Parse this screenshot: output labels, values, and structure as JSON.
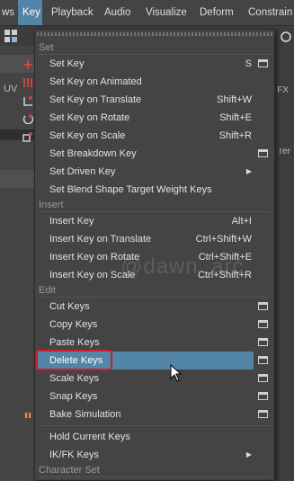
{
  "menubar": {
    "items": [
      {
        "label": "ws"
      },
      {
        "label": "Key"
      },
      {
        "label": "Playback"
      },
      {
        "label": "Audio"
      },
      {
        "label": "Visualize"
      },
      {
        "label": "Deform"
      },
      {
        "label": "Constrain"
      }
    ],
    "active": "Key"
  },
  "background": {
    "left_tab": "UV",
    "right_tab": "FX",
    "right_text": "rer"
  },
  "menu": {
    "sections": {
      "set": "Set",
      "insert": "Insert",
      "edit": "Edit",
      "character_set": "Character Set"
    },
    "items": [
      {
        "label": "Set Key",
        "shortcut": "S",
        "has_options": true
      },
      {
        "label": "Set Key on Animated",
        "shortcut": "",
        "has_options": false
      },
      {
        "label": "Set Key on Translate",
        "shortcut": "Shift+W",
        "has_options": false
      },
      {
        "label": "Set Key on Rotate",
        "shortcut": "Shift+E",
        "has_options": false
      },
      {
        "label": "Set Key on Scale",
        "shortcut": "Shift+R",
        "has_options": false
      },
      {
        "label": "Set Breakdown Key",
        "shortcut": "",
        "has_options": true
      },
      {
        "label": "Set Driven Key",
        "shortcut": "",
        "has_submenu": true
      },
      {
        "label": "Set Blend Shape Target Weight Keys",
        "shortcut": ""
      },
      {
        "label": "Insert Key",
        "shortcut": "Alt+I"
      },
      {
        "label": "Insert Key on Translate",
        "shortcut": "Ctrl+Shift+W"
      },
      {
        "label": "Insert Key on Rotate",
        "shortcut": "Ctrl+Shift+E"
      },
      {
        "label": "Insert Key on Scale",
        "shortcut": "Ctrl+Shift+R"
      },
      {
        "label": "Cut Keys",
        "has_options": true
      },
      {
        "label": "Copy Keys",
        "has_options": true
      },
      {
        "label": "Paste Keys",
        "has_options": true
      },
      {
        "label": "Delete Keys",
        "has_options": true,
        "highlighted": true
      },
      {
        "label": "Scale Keys",
        "has_options": true
      },
      {
        "label": "Snap Keys",
        "has_options": true
      },
      {
        "label": "Bake Simulation",
        "has_options": true
      },
      {
        "label": "Hold Current Keys"
      },
      {
        "label": "IK/FK Keys",
        "has_submenu": true
      }
    ]
  },
  "watermark": "@dawn_arc",
  "colors": {
    "highlight": "#5285a6",
    "annotation": "#d51a2a",
    "menu_bg": "#444444"
  }
}
